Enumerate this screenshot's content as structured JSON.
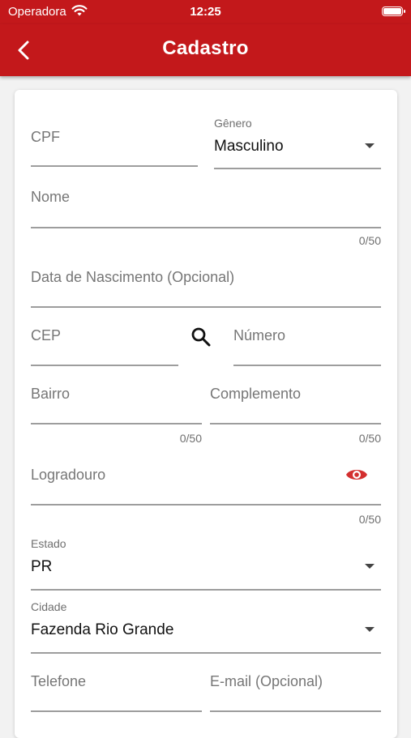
{
  "statusbar": {
    "carrier": "Operadora",
    "time": "12:25"
  },
  "appbar": {
    "title": "Cadastro",
    "back_icon": "chevron-left-icon"
  },
  "colors": {
    "brand": "#c3181b",
    "eye_icon": "#d32f2f"
  },
  "form": {
    "cpf": {
      "label": "CPF"
    },
    "genero": {
      "label": "Gênero",
      "value": "Masculino"
    },
    "nome": {
      "label": "Nome",
      "counter": "0/50"
    },
    "nascimento": {
      "label": "Data de Nascimento (Opcional)"
    },
    "cep": {
      "label": "CEP",
      "search_icon": "search-icon"
    },
    "numero": {
      "label": "Número"
    },
    "bairro": {
      "label": "Bairro",
      "counter": "0/50"
    },
    "complemento": {
      "label": "Complemento",
      "counter": "0/50"
    },
    "logradouro": {
      "label": "Logradouro",
      "counter": "0/50",
      "eye_icon": "eye-icon"
    },
    "estado": {
      "label": "Estado",
      "value": "PR"
    },
    "cidade": {
      "label": "Cidade",
      "value": "Fazenda Rio Grande"
    },
    "telefone": {
      "label": "Telefone"
    },
    "email": {
      "label": "E-mail (Opcional)"
    }
  }
}
